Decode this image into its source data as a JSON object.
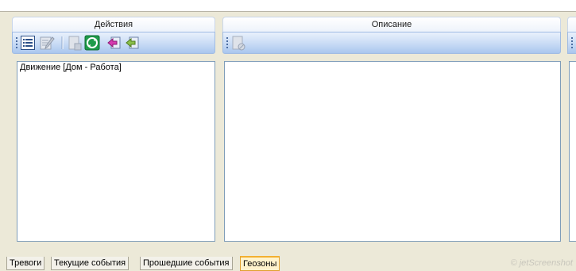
{
  "panels": {
    "actions": {
      "header": "Действия",
      "items": [
        "Движение [Дом - Работа]"
      ],
      "toolbar_icons": [
        "list-icon",
        "edit-icon",
        "document-disabled-icon",
        "recycle-icon",
        "import-icon",
        "export-icon"
      ]
    },
    "description": {
      "header": "Описание",
      "toolbar_icons": [
        "document-delete-icon"
      ]
    }
  },
  "tabs": [
    {
      "label": "Тревоги",
      "active": false
    },
    {
      "label": "Текущие события",
      "active": false
    },
    {
      "label": "Прошедшие события",
      "active": false
    },
    {
      "label": "Геозоны",
      "active": true
    }
  ],
  "watermark": "© jetScreenshot",
  "colors": {
    "toolbar_gradient_top": "#e9f1fc",
    "toolbar_gradient_bottom": "#a9c6ee",
    "active_tab_accent": "#f3b030",
    "window_background": "#ece9d8"
  }
}
